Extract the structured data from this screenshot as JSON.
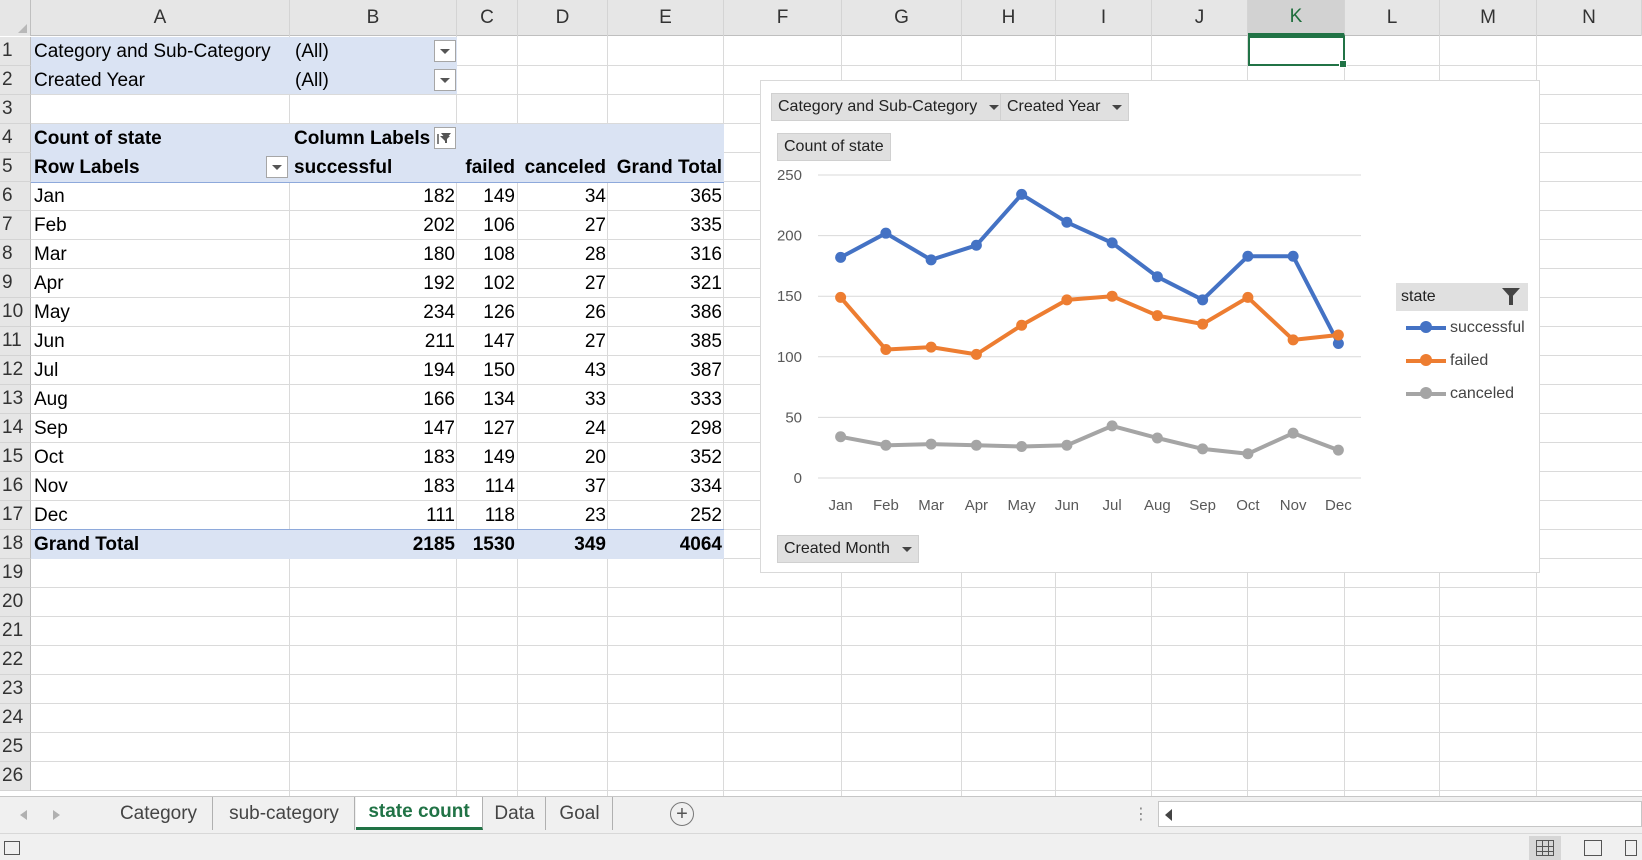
{
  "columns": [
    "A",
    "B",
    "C",
    "D",
    "E",
    "F",
    "G",
    "H",
    "I",
    "J",
    "K",
    "L",
    "M",
    "N"
  ],
  "active_column": "K",
  "rows": [
    "1",
    "2",
    "3",
    "4",
    "5",
    "6",
    "7",
    "8",
    "9",
    "10",
    "11",
    "12",
    "13",
    "14",
    "15",
    "16",
    "17",
    "18",
    "19",
    "20",
    "21",
    "22",
    "23",
    "24",
    "25",
    "26"
  ],
  "filters": [
    {
      "label": "Category and Sub-Category",
      "value": "(All)"
    },
    {
      "label": "Created Year",
      "value": "(All)"
    }
  ],
  "pivot": {
    "corner_label": "Count of state",
    "column_labels": "Column Labels",
    "row_labels": "Row Labels",
    "headers": [
      "successful",
      "failed",
      "canceled",
      "Grand Total"
    ],
    "data": [
      {
        "month": "Jan",
        "v": [
          "182",
          "149",
          "34",
          "365"
        ]
      },
      {
        "month": "Feb",
        "v": [
          "202",
          "106",
          "27",
          "335"
        ]
      },
      {
        "month": "Mar",
        "v": [
          "180",
          "108",
          "28",
          "316"
        ]
      },
      {
        "month": "Apr",
        "v": [
          "192",
          "102",
          "27",
          "321"
        ]
      },
      {
        "month": "May",
        "v": [
          "234",
          "126",
          "26",
          "386"
        ]
      },
      {
        "month": "Jun",
        "v": [
          "211",
          "147",
          "27",
          "385"
        ]
      },
      {
        "month": "Jul",
        "v": [
          "194",
          "150",
          "43",
          "387"
        ]
      },
      {
        "month": "Aug",
        "v": [
          "166",
          "134",
          "33",
          "333"
        ]
      },
      {
        "month": "Sep",
        "v": [
          "147",
          "127",
          "24",
          "298"
        ]
      },
      {
        "month": "Oct",
        "v": [
          "183",
          "149",
          "20",
          "352"
        ]
      },
      {
        "month": "Nov",
        "v": [
          "183",
          "114",
          "37",
          "334"
        ]
      },
      {
        "month": "Dec",
        "v": [
          "111",
          "118",
          "23",
          "252"
        ]
      }
    ],
    "grand_total_label": "Grand Total",
    "grand_total": [
      "2185",
      "1530",
      "349",
      "4064"
    ]
  },
  "chart_buttons": {
    "filter1": "Category and Sub-Category",
    "filter2": "Created Year",
    "values": "Count of state",
    "axis": "Created Month",
    "legend_title": "state"
  },
  "chart_data": {
    "type": "line",
    "categories": [
      "Jan",
      "Feb",
      "Mar",
      "Apr",
      "May",
      "Jun",
      "Jul",
      "Aug",
      "Sep",
      "Oct",
      "Nov",
      "Dec"
    ],
    "series": [
      {
        "name": "successful",
        "color": "#4472c4",
        "values": [
          182,
          202,
          180,
          192,
          234,
          211,
          194,
          166,
          147,
          183,
          183,
          111
        ]
      },
      {
        "name": "failed",
        "color": "#ed7d31",
        "values": [
          149,
          106,
          108,
          102,
          126,
          147,
          150,
          134,
          127,
          149,
          114,
          118
        ]
      },
      {
        "name": "canceled",
        "color": "#a5a5a5",
        "values": [
          34,
          27,
          28,
          27,
          26,
          27,
          43,
          33,
          24,
          20,
          37,
          23
        ]
      }
    ],
    "ylim": [
      0,
      250
    ],
    "yticks": [
      0,
      50,
      100,
      150,
      200,
      250
    ],
    "grid": true,
    "legend_position": "right"
  },
  "tabs": [
    {
      "label": "Category",
      "active": false
    },
    {
      "label": "sub-category",
      "active": false
    },
    {
      "label": "state count",
      "active": true
    },
    {
      "label": "Data",
      "active": false
    },
    {
      "label": "Goal",
      "active": false
    }
  ],
  "add_sheet_glyph": "+",
  "scroll_dots": "⋮"
}
